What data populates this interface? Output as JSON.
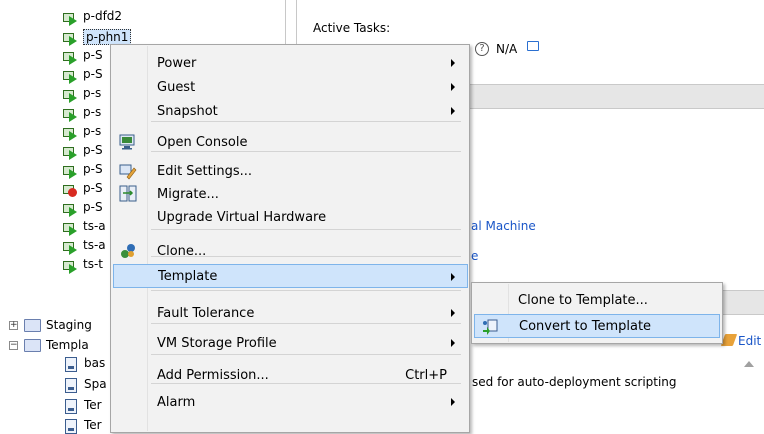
{
  "tree": {
    "vms": [
      {
        "label": "p-dfd2",
        "status": "ok",
        "selected": false
      },
      {
        "label": "p-phn1",
        "status": "ok",
        "selected": true
      },
      {
        "label": "p-S",
        "status": "ok",
        "selected": false
      },
      {
        "label": "p-S",
        "status": "ok",
        "selected": false
      },
      {
        "label": "p-s",
        "status": "ok",
        "selected": false
      },
      {
        "label": "p-s",
        "status": "ok",
        "selected": false
      },
      {
        "label": "p-s",
        "status": "ok",
        "selected": false
      },
      {
        "label": "p-S",
        "status": "ok",
        "selected": false
      },
      {
        "label": "p-S",
        "status": "ok",
        "selected": false
      },
      {
        "label": "p-S",
        "status": "error",
        "selected": false
      },
      {
        "label": "p-S",
        "status": "ok",
        "selected": false
      },
      {
        "label": "ts-a",
        "status": "ok",
        "selected": false
      },
      {
        "label": "ts-a",
        "status": "ok",
        "selected": false
      },
      {
        "label": "ts-t",
        "status": "ok",
        "selected": false
      }
    ],
    "folders": [
      {
        "label": "Staging",
        "expander": "+"
      },
      {
        "label": "Templa",
        "expander": "−"
      }
    ],
    "templates": [
      {
        "label": "bas"
      },
      {
        "label": "Spa"
      },
      {
        "label": "Ter"
      },
      {
        "label": "Ter"
      }
    ]
  },
  "panel": {
    "active_tasks_label": "Active Tasks:",
    "na_value": "N/A",
    "link_virtual_machine": "al Machine",
    "link_partial": "e",
    "edit_link": "Edit",
    "description": "sed for auto-deployment scripting",
    "link_color": "#1a56c8"
  },
  "context_menu": {
    "items": [
      {
        "label": "Power",
        "submenu": true,
        "icon": ""
      },
      {
        "label": "Guest",
        "submenu": true,
        "icon": ""
      },
      {
        "label": "Snapshot",
        "submenu": true,
        "icon": ""
      },
      {
        "label": "Open Console",
        "submenu": false,
        "icon": "console-icon"
      },
      {
        "label": "Edit Settings...",
        "submenu": false,
        "icon": "edit-settings-icon"
      },
      {
        "label": "Migrate...",
        "submenu": false,
        "icon": "migrate-icon"
      },
      {
        "label": "Upgrade Virtual Hardware",
        "submenu": false,
        "icon": ""
      },
      {
        "label": "Clone...",
        "submenu": false,
        "icon": "clone-icon"
      },
      {
        "label": "Template",
        "submenu": true,
        "icon": "",
        "highlighted": true
      },
      {
        "label": "Fault Tolerance",
        "submenu": true,
        "icon": ""
      },
      {
        "label": "VM Storage Profile",
        "submenu": true,
        "icon": ""
      },
      {
        "label": "Add Permission...",
        "submenu": false,
        "icon": "",
        "shortcut": "Ctrl+P"
      },
      {
        "label": "Alarm",
        "submenu": true,
        "icon": ""
      }
    ]
  },
  "submenu": {
    "items": [
      {
        "label": "Clone to Template...",
        "icon": ""
      },
      {
        "label": "Convert to Template",
        "icon": "convert-template-icon",
        "highlighted": true
      }
    ]
  },
  "colors": {
    "highlight_bg": "#cfe4fb",
    "highlight_border": "#7eb4ea",
    "menu_bg": "#f2f2f2"
  }
}
